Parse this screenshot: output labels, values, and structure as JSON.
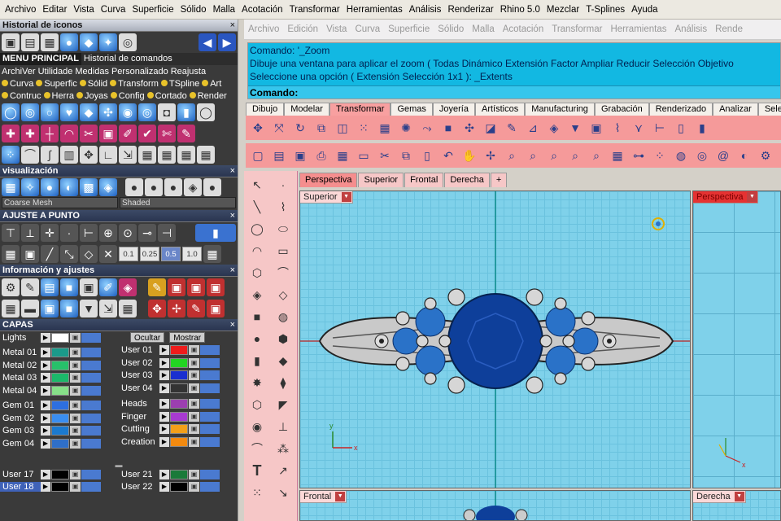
{
  "menu": [
    "Archivo",
    "Editar",
    "Vista",
    "Curva",
    "Superficie",
    "Sólido",
    "Malla",
    "Acotación",
    "Transformar",
    "Herramientas",
    "Análisis",
    "Renderizar",
    "Rhino 5.0",
    "Mezclar",
    "T-Splines",
    "Ayuda"
  ],
  "ghost_menu": [
    "Archivo",
    "Edición",
    "Vista",
    "Curva",
    "Superficie",
    "Sólido",
    "Malla",
    "Acotación",
    "Transformar",
    "Herramientas",
    "Análisis",
    "Rende"
  ],
  "left": {
    "historial_title": "Historial de iconos",
    "tabs": [
      "MENU PRINCIPAL",
      "Historial de comandos"
    ],
    "shortcuts_row1": [
      "ArchiVer",
      "Utilidade",
      "Medidas",
      "Personalizado",
      "Reajusta"
    ],
    "shortcuts_row2": [
      "Curva",
      "Superfic",
      "Sólid",
      "Transform",
      "TSpline",
      "Art"
    ],
    "shortcuts_row3": [
      "Contruc",
      "Herra",
      "Joyas",
      "Config",
      "Cortado",
      "Render"
    ],
    "vis_title": "visualización",
    "vis_select1": "Coarse Mesh",
    "vis_select2": "Shaded",
    "ajuste_title": "AJUSTE A PUNTO",
    "ajuste_values": [
      "0.1",
      "0.25",
      "0.5",
      "1.0"
    ],
    "info_title": "Información y ajustes",
    "capas_title": "CAPAS",
    "ocultar_label": "Ocultar",
    "mostrar_label": "Mostrar",
    "layers_left": [
      {
        "name": "Lights",
        "color": "#ffffff"
      },
      {
        "name": "Metal 01",
        "color": "#1a9a8a"
      },
      {
        "name": "Metal 02",
        "color": "#27c06a"
      },
      {
        "name": "Metal 03",
        "color": "#1bb86a"
      },
      {
        "name": "Metal 04",
        "color": "#86e089"
      },
      {
        "name": "Gem 01",
        "color": "#2d6fe0"
      },
      {
        "name": "Gem 02",
        "color": "#3a8ef0"
      },
      {
        "name": "Gem 03",
        "color": "#1b7ad0"
      },
      {
        "name": "Gem 04",
        "color": "#2f6fc8"
      }
    ],
    "layers_right": [
      {
        "name": "User 01",
        "color": "#ee1c1c"
      },
      {
        "name": "User 02",
        "color": "#22d422"
      },
      {
        "name": "User 03",
        "color": "#1a2fd0"
      },
      {
        "name": "User 04",
        "color": "#333333"
      },
      {
        "name": "Heads",
        "color": "#9c3fb0"
      },
      {
        "name": "Finger",
        "color": "#a83ad0"
      },
      {
        "name": "Cutting",
        "color": "#f2a01a"
      },
      {
        "name": "Creation",
        "color": "#f28a10"
      }
    ],
    "layers_bottom_left": [
      {
        "name": "User 17",
        "color": "#000000"
      },
      {
        "name": "User 18",
        "color": "#000000"
      }
    ],
    "layers_bottom_right": [
      {
        "name": "User 21",
        "color": "#1a7a3a"
      },
      {
        "name": "User 22",
        "color": "#000000"
      }
    ]
  },
  "command": {
    "line1": "Comando: '_Zoom",
    "line2": "Dibuje una ventana para aplicar el zoom ( Todas  Dinámico  Extensión  Factor  Ampliar  Reducir  Selección  Objetivo",
    "line3": "Seleccione una opción ( Extensión  Selección  1x1 ): _Extents",
    "prompt": "Comando:"
  },
  "toolbar_tabs": [
    "Dibujo",
    "Modelar",
    "Transformar",
    "Gemas",
    "Joyería",
    "Artísticos",
    "Manufacturing",
    "Grabación",
    "Renderizado",
    "Analizar",
    "Selecc"
  ],
  "viewport_tabs": [
    "Perspectiva",
    "Superior",
    "Frontal",
    "Derecha",
    "+"
  ],
  "viewports": {
    "main": "Superior",
    "right_top": "Perspectiva",
    "bottom_left": "Frontal",
    "bottom_right": "Derecha"
  },
  "colors": {
    "accent": "#f58e8e",
    "viewport": "#7fd1ea",
    "cmd": "#12b8e2",
    "gem": "#0e3f9a"
  }
}
